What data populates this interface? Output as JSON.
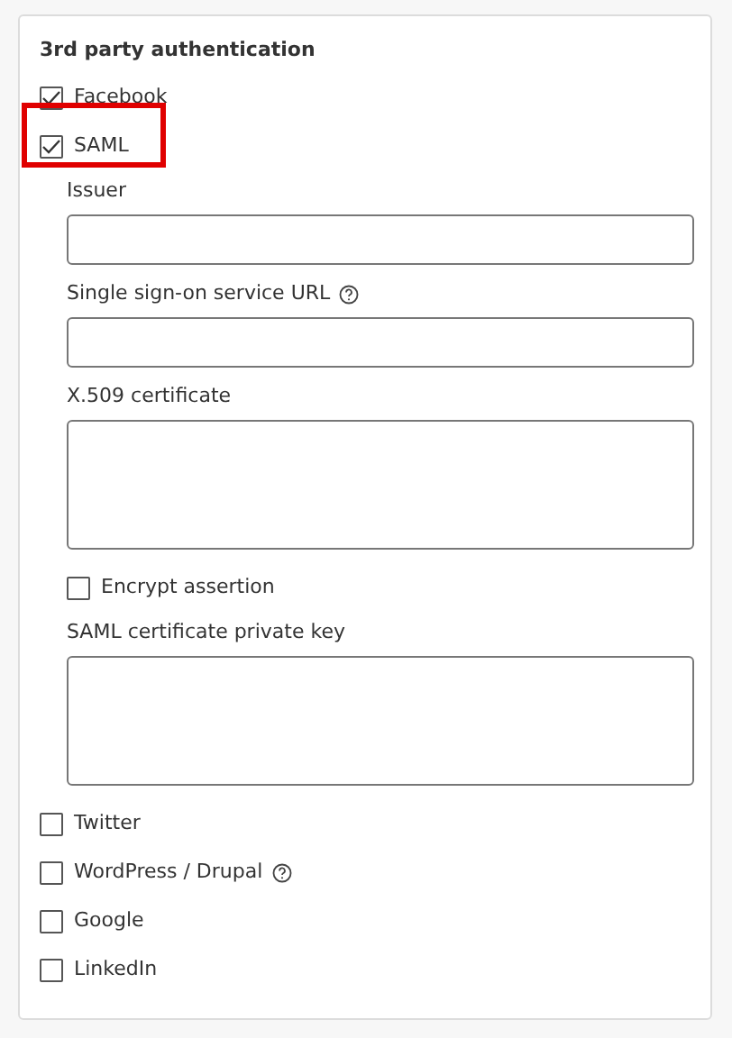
{
  "section": {
    "title": "3rd party authentication",
    "providers": [
      {
        "label": "Facebook",
        "checked": true,
        "highlighted": false,
        "help": false
      },
      {
        "label": "SAML",
        "checked": true,
        "highlighted": true,
        "help": false,
        "settings": [
          {
            "kind": "input",
            "label": "Issuer",
            "help": false
          },
          {
            "kind": "input",
            "label": "Single sign-on service URL",
            "help": true
          },
          {
            "kind": "textarea",
            "label": "X.509 certificate",
            "help": false
          },
          {
            "kind": "checkbox",
            "label": "Encrypt assertion",
            "checked": false,
            "help": false
          },
          {
            "kind": "textarea",
            "label": "SAML certificate private key",
            "help": false
          }
        ]
      },
      {
        "label": "Twitter",
        "checked": false,
        "highlighted": false,
        "help": false
      },
      {
        "label": "WordPress / Drupal",
        "checked": false,
        "highlighted": false,
        "help": true
      },
      {
        "label": "Google",
        "checked": false,
        "highlighted": false,
        "help": false
      },
      {
        "label": "LinkedIn",
        "checked": false,
        "highlighted": false,
        "help": false
      }
    ]
  }
}
